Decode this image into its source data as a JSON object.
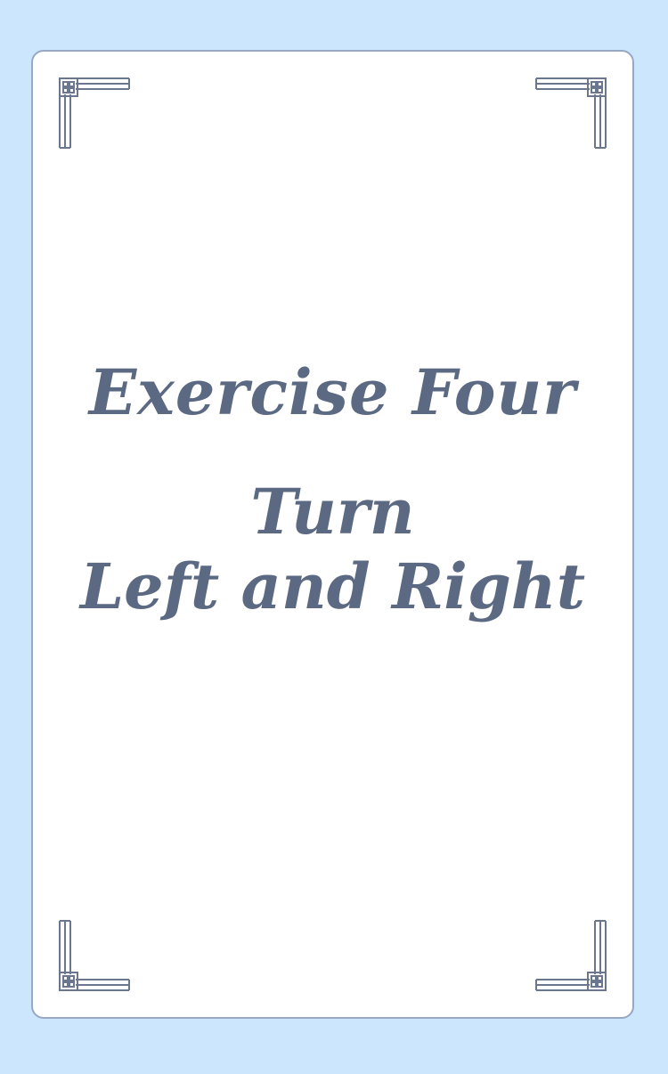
{
  "heading": "Exercise Four",
  "subtitle": {
    "line1": "Turn",
    "line2": "Left and Right"
  },
  "colors": {
    "background": "#cbe6fd",
    "card": "#ffffff",
    "card_border": "#98a8c4",
    "text": "#5b6a82",
    "ornament": "#6a778f"
  },
  "ornament_icon": "greek-key-corner-icon"
}
